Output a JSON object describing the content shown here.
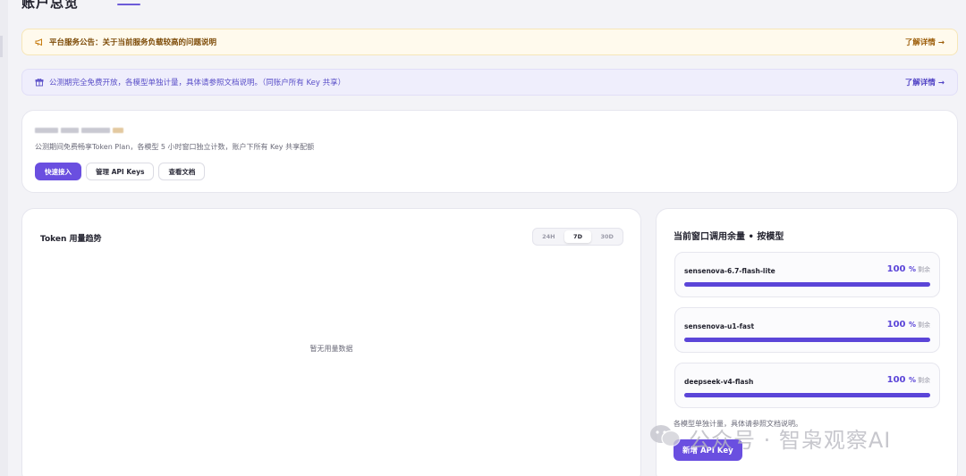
{
  "page": {
    "title": "账户总览"
  },
  "announcement": {
    "text": "平台服务公告：关于当前服务负载较高的问题说明",
    "link": "了解详情 →",
    "icon": "megaphone-icon"
  },
  "info_banner": {
    "text": "公测期完全免费开放，各模型单独计量，具体请参照文档说明。（同账户所有 Key 共享）",
    "link": "了解详情 →",
    "icon": "gift-icon"
  },
  "plan": {
    "description": "公测期间免费畅享Token Plan，各模型 5 小时窗口独立计数，账户下所有 Key 共享配额",
    "actions": {
      "quick_start": "快速接入",
      "manage_keys": "管理 API Keys",
      "docs": "查看文档"
    }
  },
  "usage": {
    "title": "Token 用量趋势",
    "ranges": [
      "24H",
      "7D",
      "30D"
    ],
    "selected_range": "7D",
    "empty": "暂无用量数据"
  },
  "quota": {
    "title": "当前窗口调用余量 • 按模型",
    "models": [
      {
        "name": "sensenova-6.7-flash-lite",
        "value": "100",
        "unit": "%",
        "label": "剩余",
        "fraction": 1.0
      },
      {
        "name": "sensenova-u1-fast",
        "value": "100",
        "unit": "%",
        "label": "剩余",
        "fraction": 1.0
      },
      {
        "name": "deepseek-v4-flash",
        "value": "100",
        "unit": "%",
        "label": "剩余",
        "fraction": 1.0
      }
    ],
    "note": "各模型单独计量，具体请参照文档说明。",
    "new_key": "新增 API Key"
  },
  "watermark": {
    "text": "公众号 · 智枭观察AI"
  },
  "colors": {
    "accent": "#6a4fe0",
    "bar": "#5b45d8",
    "announce_bg": "#fffaed",
    "info_bg": "#efeefc"
  }
}
